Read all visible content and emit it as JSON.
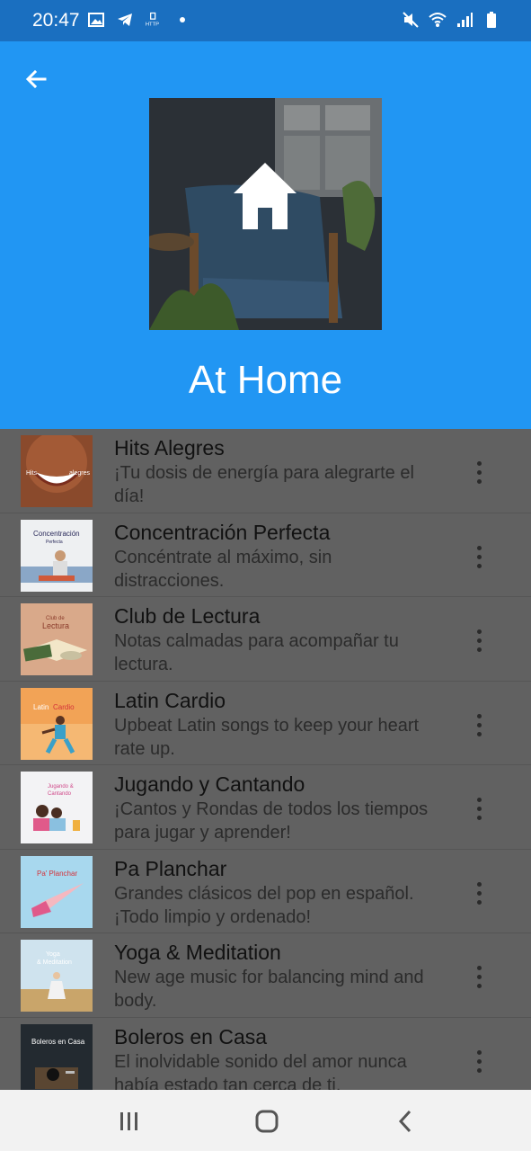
{
  "status_bar": {
    "time": "20:47",
    "left_icons": [
      "image-icon",
      "telegram-icon",
      "http-icon",
      "dot-icon"
    ],
    "right_icons": [
      "mute-icon",
      "wifi-icon",
      "signal-icon",
      "battery-icon"
    ]
  },
  "header": {
    "title": "At Home",
    "background_color": "#2196f3",
    "cover_icon": "home-icon"
  },
  "playlists": [
    {
      "title": "Hits Alegres",
      "description": "¡Tu dosis de energía para alegrarte el día!",
      "thumb_text": "Hits alegres"
    },
    {
      "title": "Concentración Perfecta",
      "description": "Concéntrate al máximo, sin distracciones.",
      "thumb_text": "Concentración Perfecta"
    },
    {
      "title": "Club de Lectura",
      "description": "Notas calmadas para acompañar tu lectura.",
      "thumb_text": "Club de Lectura"
    },
    {
      "title": "Latin Cardio",
      "description": "Upbeat Latin songs to keep your heart rate up.",
      "thumb_text": "Latin Cardio"
    },
    {
      "title": "Jugando y Cantando",
      "description": "¡Cantos y Rondas de todos los tiempos para jugar y aprender!",
      "thumb_text": "Jugando & Cantando"
    },
    {
      "title": "Pa Planchar",
      "description": "Grandes clásicos del pop en español. ¡Todo limpio y ordenado!",
      "thumb_text": "Pa' Planchar"
    },
    {
      "title": "Yoga & Meditation",
      "description": "New age music for balancing mind and body.",
      "thumb_text": "Yoga & Meditation"
    },
    {
      "title": "Boleros en Casa",
      "description": "El inolvidable sonido del amor nunca había estado tan cerca de ti.",
      "thumb_text": "Boleros en Casa"
    }
  ],
  "nav_bar": {
    "recents": "recents-icon",
    "home": "home-circle-icon",
    "back": "back-chevron-icon"
  }
}
